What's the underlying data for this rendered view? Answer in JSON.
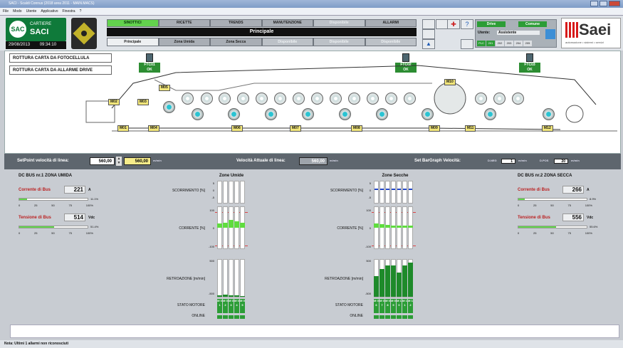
{
  "window": {
    "title": "SACI - Scaldi Connus (2018 area 2011 - MAIN.MACS)",
    "menus": [
      "File",
      "Modo",
      "Utente",
      "Applicativo",
      "Finestra",
      "?"
    ]
  },
  "header": {
    "logo_line1": "CARTIERE",
    "logo_line2": "SACI",
    "logo_circle": "SAC",
    "date": "29/08/2013",
    "time": "09:34:10",
    "nav_tabs": [
      "SINOTTICI",
      "RICETTE",
      "TRENDS",
      "MANUTENZIONE",
      "Disponibile",
      "ALLARMI"
    ],
    "main_title": "Principale",
    "sub_tabs": [
      "Principale",
      "Zona Umida",
      "Zona Secca",
      "Disponibile",
      "Disponibile",
      "Disponibile"
    ],
    "user": {
      "drive_label": "Drive",
      "comune_label": "Comune",
      "utente_label": "Utente:",
      "utente_value": "Assistente",
      "plc_label": "PLC",
      "plc_items": [
        "201",
        "202",
        "203",
        "204",
        "205"
      ]
    },
    "brand": {
      "word": "Saei",
      "tagline": "automazione • sistemi • servizi"
    }
  },
  "synoptic": {
    "alarm_buttons": [
      "ROTTURA CARTA DA FOTOCELLULA",
      "ROTTURA CARTA DA ALLARME DRIVE"
    ],
    "photocells": [
      {
        "name": "FTC01",
        "state": "OK"
      },
      {
        "name": "FTC02",
        "state": "OK"
      },
      {
        "name": "FTC03",
        "state": "OK"
      }
    ],
    "motors": [
      "M01",
      "M02",
      "M03",
      "M04",
      "M05",
      "M06",
      "M07",
      "M08",
      "M09",
      "M10",
      "M11",
      "M12"
    ]
  },
  "setbar": {
    "setpoint_label": "SetPoint velocità di linea:",
    "setpoint_value": "560,00",
    "setpoint_value2": "560,00",
    "unit": "m/min",
    "actual_label": "Velocità Attuale di linea:",
    "actual_value": "560,00",
    "actual_unit": "m/min",
    "bargraph_label": "Set BarGraph Velocità:",
    "dneg_label": "D.NEG",
    "dneg_value": "1",
    "dpos_label": "D.POS",
    "dpos_value": "20"
  },
  "bus1": {
    "title": "DC BUS nr.1 ZONA UMIDA",
    "current_label": "Corrente di Bus",
    "current_value": "221",
    "current_unit": "A",
    "current_pct": "11.1%",
    "current_frac": 0.111,
    "voltage_label": "Tensione di Bus",
    "voltage_value": "514",
    "voltage_unit": "Vdc",
    "voltage_pct": "51.4%",
    "voltage_frac": 0.514
  },
  "bus2": {
    "title": "DC BUS nr.2 ZONA SECCA",
    "current_label": "Corrente di Bus",
    "current_value": "266",
    "current_unit": "A",
    "current_pct": "8.9%",
    "current_frac": 0.089,
    "voltage_label": "Tensione di Bus",
    "voltage_value": "556",
    "voltage_unit": "Vdc",
    "voltage_pct": "55.6%",
    "voltage_frac": 0.556
  },
  "scale_ticks": [
    "0",
    "25",
    "50",
    "75",
    "100%"
  ],
  "zone_umida": {
    "title": "Zone Umide",
    "rows": {
      "scorr": "SCORRIMENTO [%]",
      "corr": "CORRENTE [%]",
      "retro": "RETROAZIONE [m/min]",
      "stato": "STATO MOTORE",
      "online": "ONLINE"
    },
    "ticks_scorr": [
      "5",
      "0",
      "-5"
    ],
    "ticks_corr": [
      "100",
      "0",
      "-100"
    ],
    "ticks_retro": [
      "500",
      "",
      "-500"
    ],
    "columns": [
      {
        "motor": "M 0 1",
        "corr": 0.1,
        "retro": 0.03
      },
      {
        "motor": "M 0 2",
        "corr": 0.12,
        "retro": 0.06
      },
      {
        "motor": "M 0 3",
        "corr": 0.18,
        "retro": 0.04
      },
      {
        "motor": "M 0 4",
        "corr": 0.15,
        "retro": 0.03
      },
      {
        "motor": "M 0 5",
        "corr": 0.12,
        "retro": 0.02
      }
    ]
  },
  "zone_secca": {
    "title": "Zone Secche",
    "rows": {
      "scorr": "SCORRIMENTO [%]",
      "corr": "CORRENTE [%]",
      "retro": "RETROAZIONE [m/min]",
      "stato": "STATO MOTORE",
      "online": "ONLINE"
    },
    "ticks_scorr": [
      "5",
      "0",
      "-5"
    ],
    "ticks_corr": [
      "100",
      "0",
      "-100"
    ],
    "ticks_retro": [
      "500",
      "",
      "-500"
    ],
    "columns": [
      {
        "motor": "M 0 6",
        "corr": 0.1,
        "retro": 0.55
      },
      {
        "motor": "M 0 7",
        "corr": 0.08,
        "retro": 0.75
      },
      {
        "motor": "M 0 8",
        "corr": 0.06,
        "retro": 0.85
      },
      {
        "motor": "M 0 9",
        "corr": 0.05,
        "retro": 0.85
      },
      {
        "motor": "M 1 0",
        "corr": 0.05,
        "retro": 0.65
      },
      {
        "motor": "M 1 1",
        "corr": 0.05,
        "retro": 0.85
      },
      {
        "motor": "M 1 2",
        "corr": 0.05,
        "retro": 0.92
      }
    ]
  },
  "status": {
    "text": "Nota: Ultimi 1 allarmi non riconosciuti"
  },
  "colors": {
    "green": "#2c9d36",
    "active_tab": "#63d24d",
    "accent_red": "#d71a1a"
  }
}
